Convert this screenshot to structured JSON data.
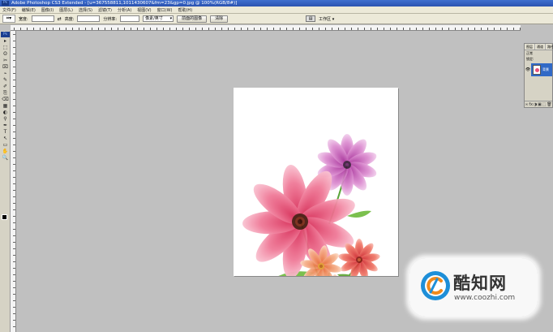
{
  "window": {
    "title": "Adobe Photoshop CS3 Extended - [u=367558811,1011430607&fm=23&gp=0.jpg @ 100%(RGB/8#)]",
    "app_badge": "Ps"
  },
  "menubar": {
    "items": [
      "文件(F)",
      "编辑(E)",
      "图像(I)",
      "图层(L)",
      "选择(S)",
      "滤镜(T)",
      "分析(A)",
      "视图(V)",
      "窗口(W)",
      "帮助(H)"
    ]
  },
  "options": {
    "width_label": "宽度:",
    "height_label": "高度:",
    "resolution_label": "分辨率:",
    "unit_value": "像素/英寸",
    "front_image_label": "前面的图像",
    "clear_label": "清除",
    "workspace_label": "工作区 ▾"
  },
  "toolbox": {
    "logo": "Ps",
    "tools": [
      "▸",
      "⬚",
      "ʘ",
      "✂",
      "⌧",
      "⌁",
      "✎",
      "✐",
      "⎘",
      "⌫",
      "▦",
      "◐",
      "⚲",
      "✒",
      "T",
      "↖",
      "▭",
      "✋",
      "🔍"
    ]
  },
  "layers_panel": {
    "tabs": [
      "图层",
      "通道",
      "路径"
    ],
    "blend_mode": "正常",
    "lock_label": "锁定:",
    "layer_name": "背景",
    "footer_icons": [
      "∞",
      "fx",
      "◑",
      "▣",
      "⬚",
      "🗑"
    ]
  },
  "canvas": {
    "zoom": "100%",
    "image_subject": "flower-illustration"
  },
  "watermark": {
    "brand": "酷知网",
    "url": "www.coozhi.com"
  },
  "colors": {
    "title_bar": "#2a52b0",
    "chrome": "#ece9d8",
    "workspace": "#c0c0c0",
    "layer_selected": "#3169c6",
    "foreground": "#000000",
    "background": "#ffffff"
  }
}
